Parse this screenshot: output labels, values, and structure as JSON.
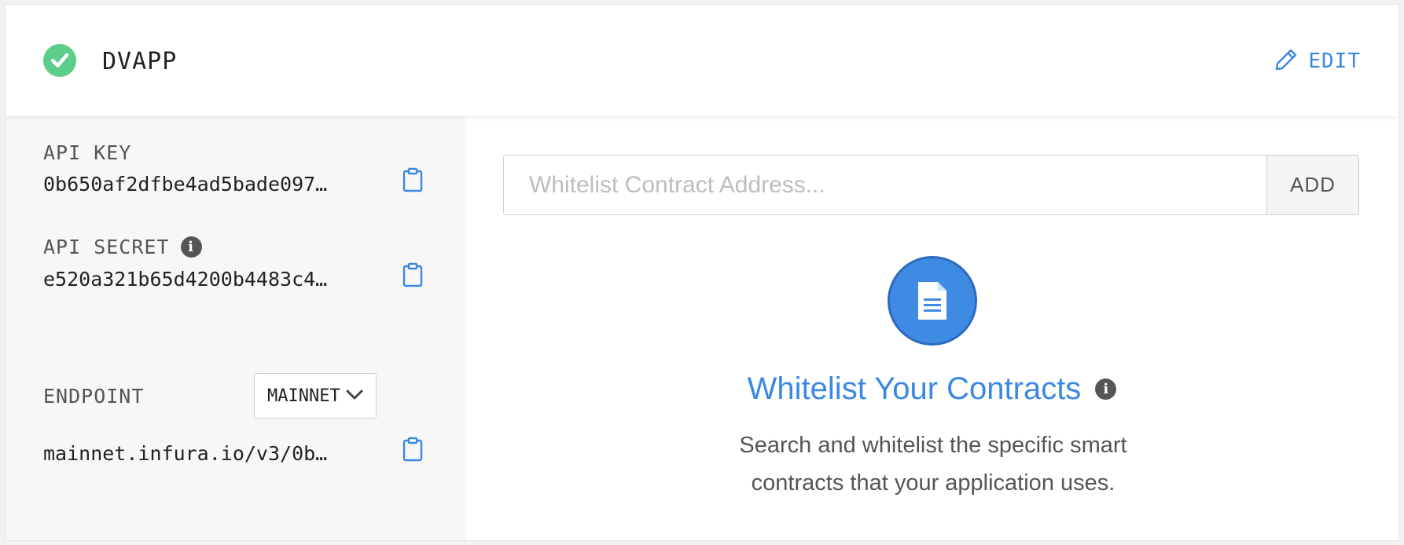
{
  "app": {
    "name": "DVAPP",
    "status_icon": "check-circle-icon",
    "edit_label": "EDIT",
    "edit_icon": "pencil-icon"
  },
  "credentials": {
    "api_key_label": "API KEY",
    "api_key_value": "0b650af2dfbe4ad5bade097…",
    "api_secret_label": "API SECRET",
    "api_secret_value": "e520a321b65d4200b4483c4…",
    "endpoint_label": "ENDPOINT",
    "endpoint_selected": "MAINNET",
    "endpoint_value": "mainnet.infura.io/v3/0b…"
  },
  "whitelist": {
    "search_placeholder": "Whitelist Contract Address...",
    "search_value": "",
    "add_label": "ADD",
    "empty_title": "Whitelist Your Contracts",
    "empty_description": "Search and whitelist the specific smart contracts that your application uses."
  },
  "colors": {
    "accent": "#3b88e3",
    "success": "#5ccd8a",
    "panel_bg": "#f7f7f7"
  }
}
